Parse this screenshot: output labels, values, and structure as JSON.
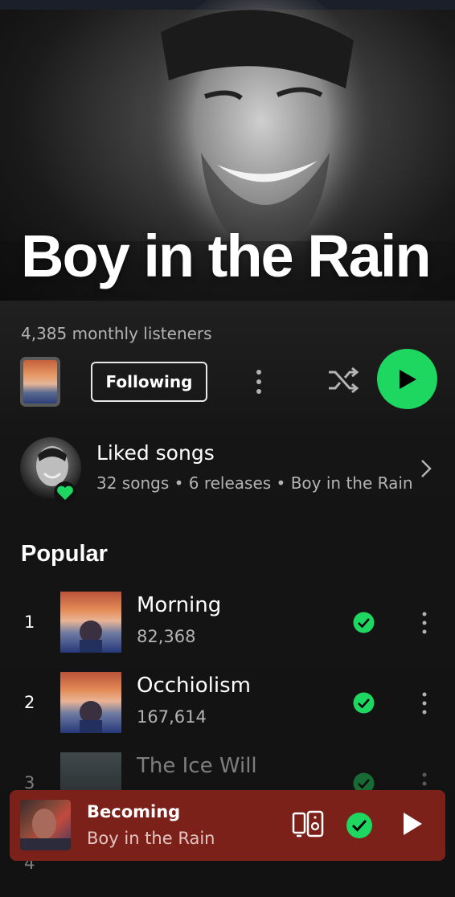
{
  "artist": {
    "name": "Boy in the Rain",
    "monthly_listeners": "4,385 monthly listeners"
  },
  "controls": {
    "follow_label": "Following",
    "more_icon": "more-vertical-icon",
    "shuffle_icon": "shuffle-icon",
    "play_icon": "play-icon"
  },
  "liked": {
    "title": "Liked songs",
    "subtitle": "32 songs • 6 releases • Boy in the Rain"
  },
  "popular": {
    "heading": "Popular",
    "tracks": [
      {
        "rank": "1",
        "title": "Morning",
        "plays": "82,368",
        "saved": true
      },
      {
        "rank": "2",
        "title": "Occhiolism",
        "plays": "167,614",
        "saved": true
      },
      {
        "rank": "3",
        "title": "The Ice Will",
        "plays": "",
        "saved": true
      },
      {
        "rank": "4",
        "title": "",
        "plays": "",
        "saved": true
      }
    ]
  },
  "player": {
    "title": "Becoming",
    "artist": "Boy in the Rain",
    "device_icon": "connect-device-icon",
    "saved_icon": "check-circle-icon",
    "play_icon": "play-icon"
  },
  "colors": {
    "accent": "#1ed760",
    "background": "#121212",
    "player_bg": "#7b2119"
  }
}
